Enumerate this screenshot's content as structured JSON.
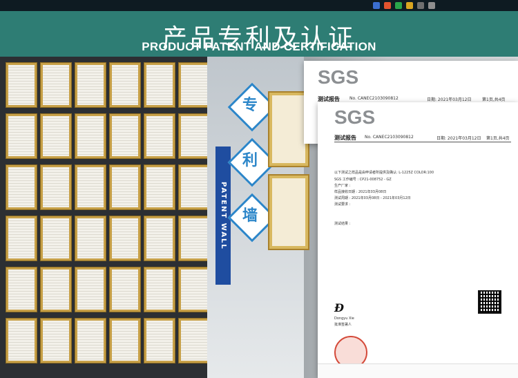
{
  "header": {
    "title_cn": "产品专利及认证",
    "title_en": "PRODUCT PATENT AND CERTIFICATION"
  },
  "photo": {
    "wall_chars": [
      "专",
      "利",
      "墙"
    ],
    "wall_sign": "PATENT WALL"
  },
  "documents": {
    "logo": "SGS",
    "doc1": {
      "title": "测试报告",
      "number": "No. CANEC2103090812",
      "date": "日期: 2021年03月12日",
      "page": "第1页,共4页"
    },
    "doc2": {
      "title": "测试报告",
      "number": "No. CANEC2103090812",
      "date": "日期: 2021年03月12日",
      "page": "第1页,共4页",
      "lines": [
        "以下测试之样品是由申请者所提供及确认: L-1225Z COLOR:100",
        "SGS 工作编号 : CP21-008752 - GZ",
        "生产厂家 :",
        "样品接收日期 : 2021年03月08日",
        "测试周期 : 2021年03月08日 - 2021年03月12日",
        "测试要求 :",
        "测试结果 :"
      ],
      "signer": "Dongyu Xie",
      "signer_title": "批准签署人"
    }
  }
}
